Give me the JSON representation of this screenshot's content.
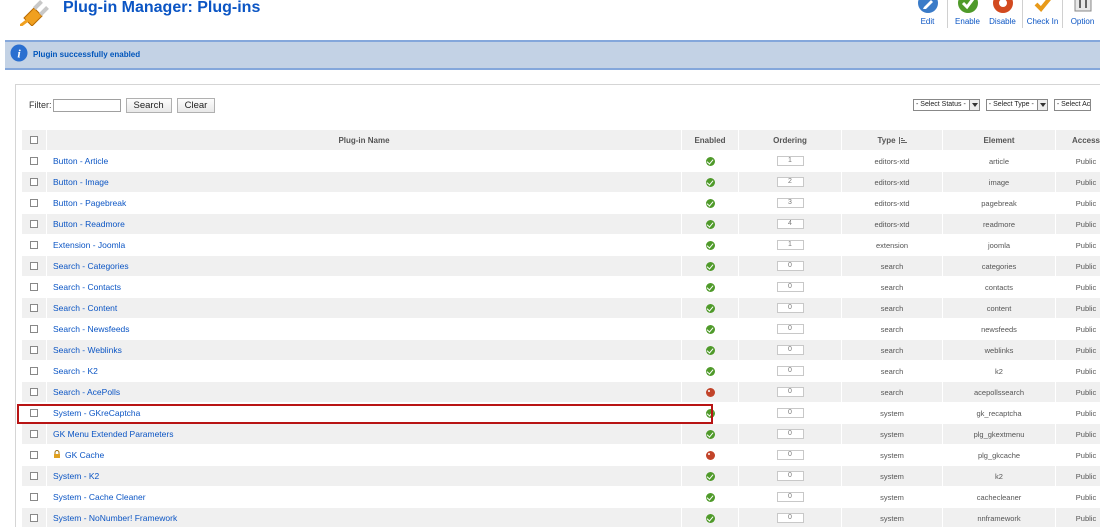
{
  "header": {
    "title": "Plug-in Manager: Plug-ins",
    "toolbar": [
      {
        "label": "Edit",
        "icon": "edit-icon",
        "color": "#3a7bc8"
      },
      {
        "label": "Enable",
        "icon": "enable-icon",
        "color": "#4f9a2a"
      },
      {
        "label": "Disable",
        "icon": "disable-icon",
        "color": "#d24a1f"
      },
      {
        "label": "Check In",
        "icon": "checkin-icon",
        "color": "#e89a1a"
      },
      {
        "label": "Option",
        "icon": "options-icon",
        "color": "#888888"
      }
    ]
  },
  "message": {
    "text": "Plugin successfully enabled"
  },
  "filter": {
    "label": "Filter:",
    "value": "",
    "search_label": "Search",
    "clear_label": "Clear",
    "selects": [
      "- Select Status -",
      "- Select Type -",
      "- Select Ac"
    ]
  },
  "table": {
    "columns": {
      "name": "Plug-in Name",
      "enabled": "Enabled",
      "ordering": "Ordering",
      "type": "Type",
      "element": "Element",
      "access": "Access"
    },
    "rows": [
      {
        "name": "Button - Article",
        "enabled": true,
        "ordering": "1",
        "type": "editors-xtd",
        "element": "article",
        "access": "Public"
      },
      {
        "name": "Button - Image",
        "enabled": true,
        "ordering": "2",
        "type": "editors-xtd",
        "element": "image",
        "access": "Public"
      },
      {
        "name": "Button - Pagebreak",
        "enabled": true,
        "ordering": "3",
        "type": "editors-xtd",
        "element": "pagebreak",
        "access": "Public"
      },
      {
        "name": "Button - Readmore",
        "enabled": true,
        "ordering": "4",
        "type": "editors-xtd",
        "element": "readmore",
        "access": "Public"
      },
      {
        "name": "Extension - Joomla",
        "enabled": true,
        "ordering": "1",
        "type": "extension",
        "element": "joomla",
        "access": "Public"
      },
      {
        "name": "Search - Categories",
        "enabled": true,
        "ordering": "0",
        "type": "search",
        "element": "categories",
        "access": "Public"
      },
      {
        "name": "Search - Contacts",
        "enabled": true,
        "ordering": "0",
        "type": "search",
        "element": "contacts",
        "access": "Public"
      },
      {
        "name": "Search - Content",
        "enabled": true,
        "ordering": "0",
        "type": "search",
        "element": "content",
        "access": "Public"
      },
      {
        "name": "Search - Newsfeeds",
        "enabled": true,
        "ordering": "0",
        "type": "search",
        "element": "newsfeeds",
        "access": "Public"
      },
      {
        "name": "Search - Weblinks",
        "enabled": true,
        "ordering": "0",
        "type": "search",
        "element": "weblinks",
        "access": "Public"
      },
      {
        "name": "Search - K2",
        "enabled": true,
        "ordering": "0",
        "type": "search",
        "element": "k2",
        "access": "Public"
      },
      {
        "name": "Search - AcePolls",
        "enabled": false,
        "ordering": "0",
        "type": "search",
        "element": "acepollssearch",
        "access": "Public"
      },
      {
        "name": "System - GKreCaptcha",
        "enabled": true,
        "ordering": "0",
        "type": "system",
        "element": "gk_recaptcha",
        "access": "Public"
      },
      {
        "name": "GK Menu Extended Parameters",
        "enabled": true,
        "ordering": "0",
        "type": "system",
        "element": "plg_gkextmenu",
        "access": "Public"
      },
      {
        "name": "GK Cache",
        "enabled": false,
        "ordering": "0",
        "type": "system",
        "element": "plg_gkcache",
        "access": "Public",
        "locked": true
      },
      {
        "name": "System - K2",
        "enabled": true,
        "ordering": "0",
        "type": "system",
        "element": "k2",
        "access": "Public"
      },
      {
        "name": "System - Cache Cleaner",
        "enabled": true,
        "ordering": "0",
        "type": "system",
        "element": "cachecleaner",
        "access": "Public"
      },
      {
        "name": "System - NoNumber! Framework",
        "enabled": true,
        "ordering": "0",
        "type": "system",
        "element": "nnframework",
        "access": "Public"
      }
    ]
  },
  "colors": {
    "title": "#0b55c4",
    "message_bg": "#c3d2e5",
    "highlight": "#b81414"
  }
}
